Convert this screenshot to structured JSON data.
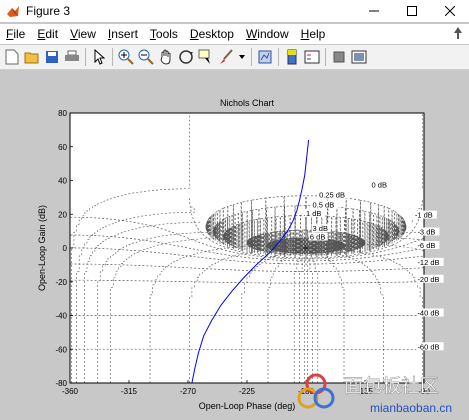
{
  "window": {
    "title": "Figure 3"
  },
  "menu": [
    {
      "first": "F",
      "rest": "ile"
    },
    {
      "first": "E",
      "rest": "dit"
    },
    {
      "first": "V",
      "rest": "iew"
    },
    {
      "first": "I",
      "rest": "nsert"
    },
    {
      "first": "T",
      "rest": "ools"
    },
    {
      "first": "D",
      "rest": "esktop"
    },
    {
      "first": "W",
      "rest": "indow"
    },
    {
      "first": "H",
      "rest": "elp"
    }
  ],
  "toolbar_icons": [
    "new-figure-icon",
    "open-file-icon",
    "save-icon",
    "print-icon",
    "edit-plot-icon",
    "zoom-in-icon",
    "zoom-out-icon",
    "pan-icon",
    "rotate-3d-icon",
    "data-cursor-icon",
    "brush-icon",
    "link-plot-icon",
    "insert-colorbar-icon",
    "insert-legend-icon",
    "hide-plot-tools-icon",
    "show-plot-tools-icon"
  ],
  "colors": {
    "curve": "#0000ff",
    "grid": "#555555",
    "axes_bg": "#ffffff",
    "figure_bg": "#c8c8c8"
  },
  "chart_data": {
    "type": "line",
    "title": "Nichols Chart",
    "xlabel": "Open-Loop Phase (deg)",
    "ylabel": "Open-Loop Gain (dB)",
    "xlim": [
      -360,
      -90
    ],
    "ylim": [
      -80,
      80
    ],
    "xticks": [
      -360,
      -315,
      -270,
      -225,
      -180,
      -135,
      -90
    ],
    "yticks": [
      -80,
      -60,
      -40,
      -20,
      0,
      20,
      40,
      60,
      80
    ],
    "xtick_labels": [
      "-360",
      "-315",
      "-270",
      "-225",
      "-180",
      "-135",
      "-90"
    ],
    "ytick_labels": [
      "-80",
      "-60",
      "-40",
      "-20",
      "0",
      "20",
      "40",
      "60",
      "80"
    ],
    "series": [
      {
        "x": [
          -267,
          -265,
          -262,
          -258,
          -252,
          -245,
          -237,
          -228,
          -218,
          -208,
          -200,
          -194,
          -190,
          -187,
          -185,
          -183,
          -181,
          -180,
          -179,
          -178
        ],
        "y": [
          -80,
          -72,
          -62,
          -52,
          -43,
          -34,
          -26,
          -18,
          -10,
          -3,
          4,
          10,
          16,
          22,
          28,
          35,
          43,
          50,
          57,
          64
        ]
      }
    ],
    "m_circle_labels": [
      "0 dB",
      "0.25 dB",
      "0.5 dB",
      "1 dB",
      "3 dB",
      "6 dB",
      "-1 dB",
      "-3 dB",
      "-6 dB",
      "-12 dB",
      "-20 dB",
      "-40 dB",
      "-60 dB"
    ],
    "grid": true
  },
  "watermark": {
    "text": "面包板社区",
    "url": "mianbaoban.cn"
  }
}
